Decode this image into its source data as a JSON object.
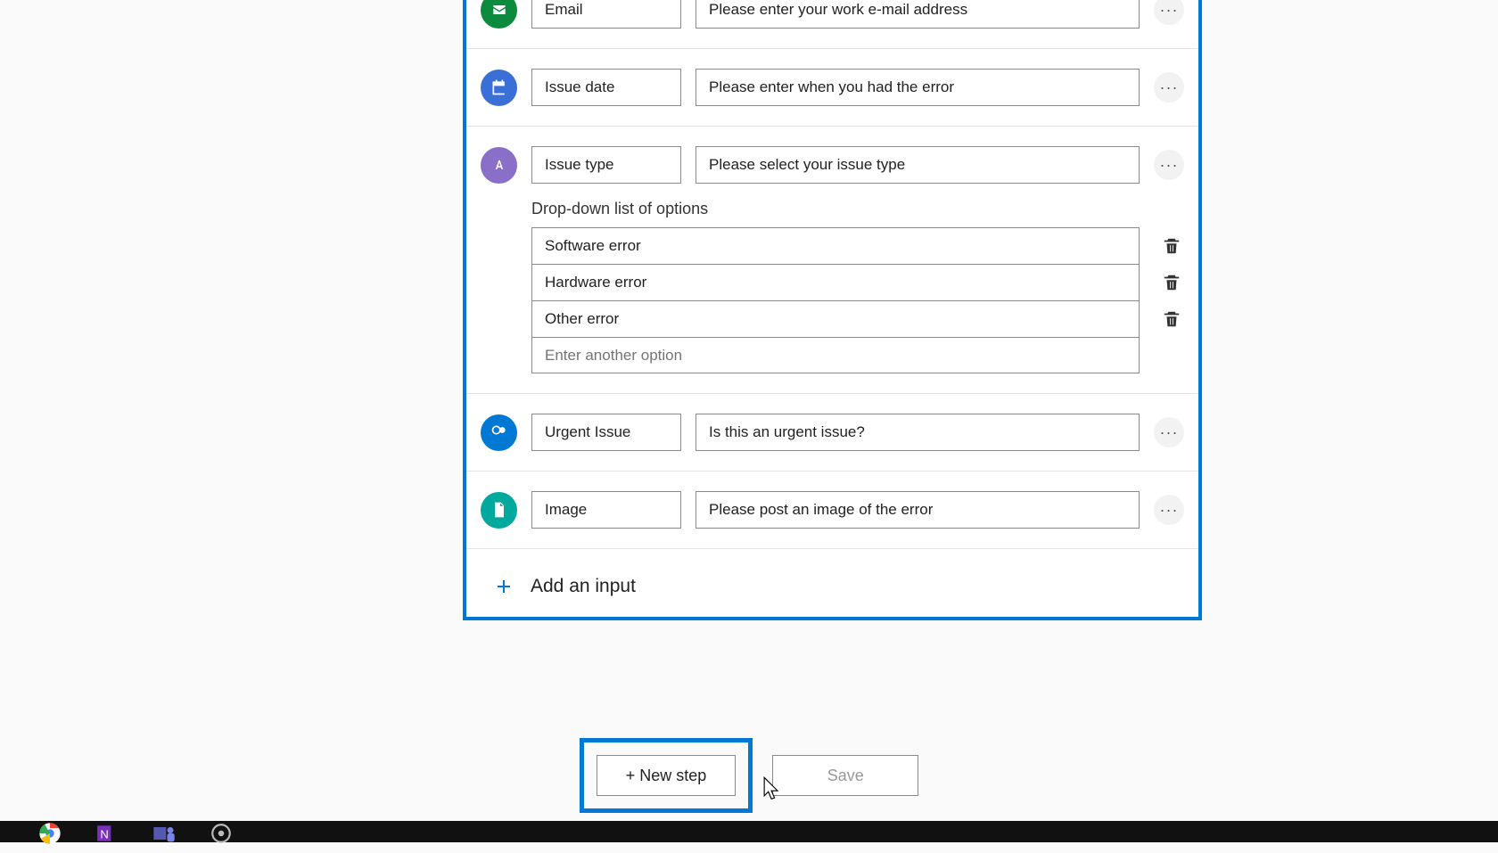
{
  "inputs": {
    "email": {
      "name": "Email",
      "desc": "Please enter your work e-mail address"
    },
    "date": {
      "name": "Issue date",
      "desc": "Please enter when you had the error"
    },
    "type": {
      "name": "Issue type",
      "desc": "Please select your issue type",
      "dropdown_label": "Drop-down list of options",
      "options": [
        "Software error",
        "Hardware error",
        "Other error"
      ],
      "new_option_placeholder": "Enter another option"
    },
    "urgent": {
      "name": "Urgent Issue",
      "desc": "Is this an urgent issue?"
    },
    "image": {
      "name": "Image",
      "desc": "Please post an image of the error"
    }
  },
  "add_input_label": "Add an input",
  "new_step_label": "+ New step",
  "save_label": "Save"
}
